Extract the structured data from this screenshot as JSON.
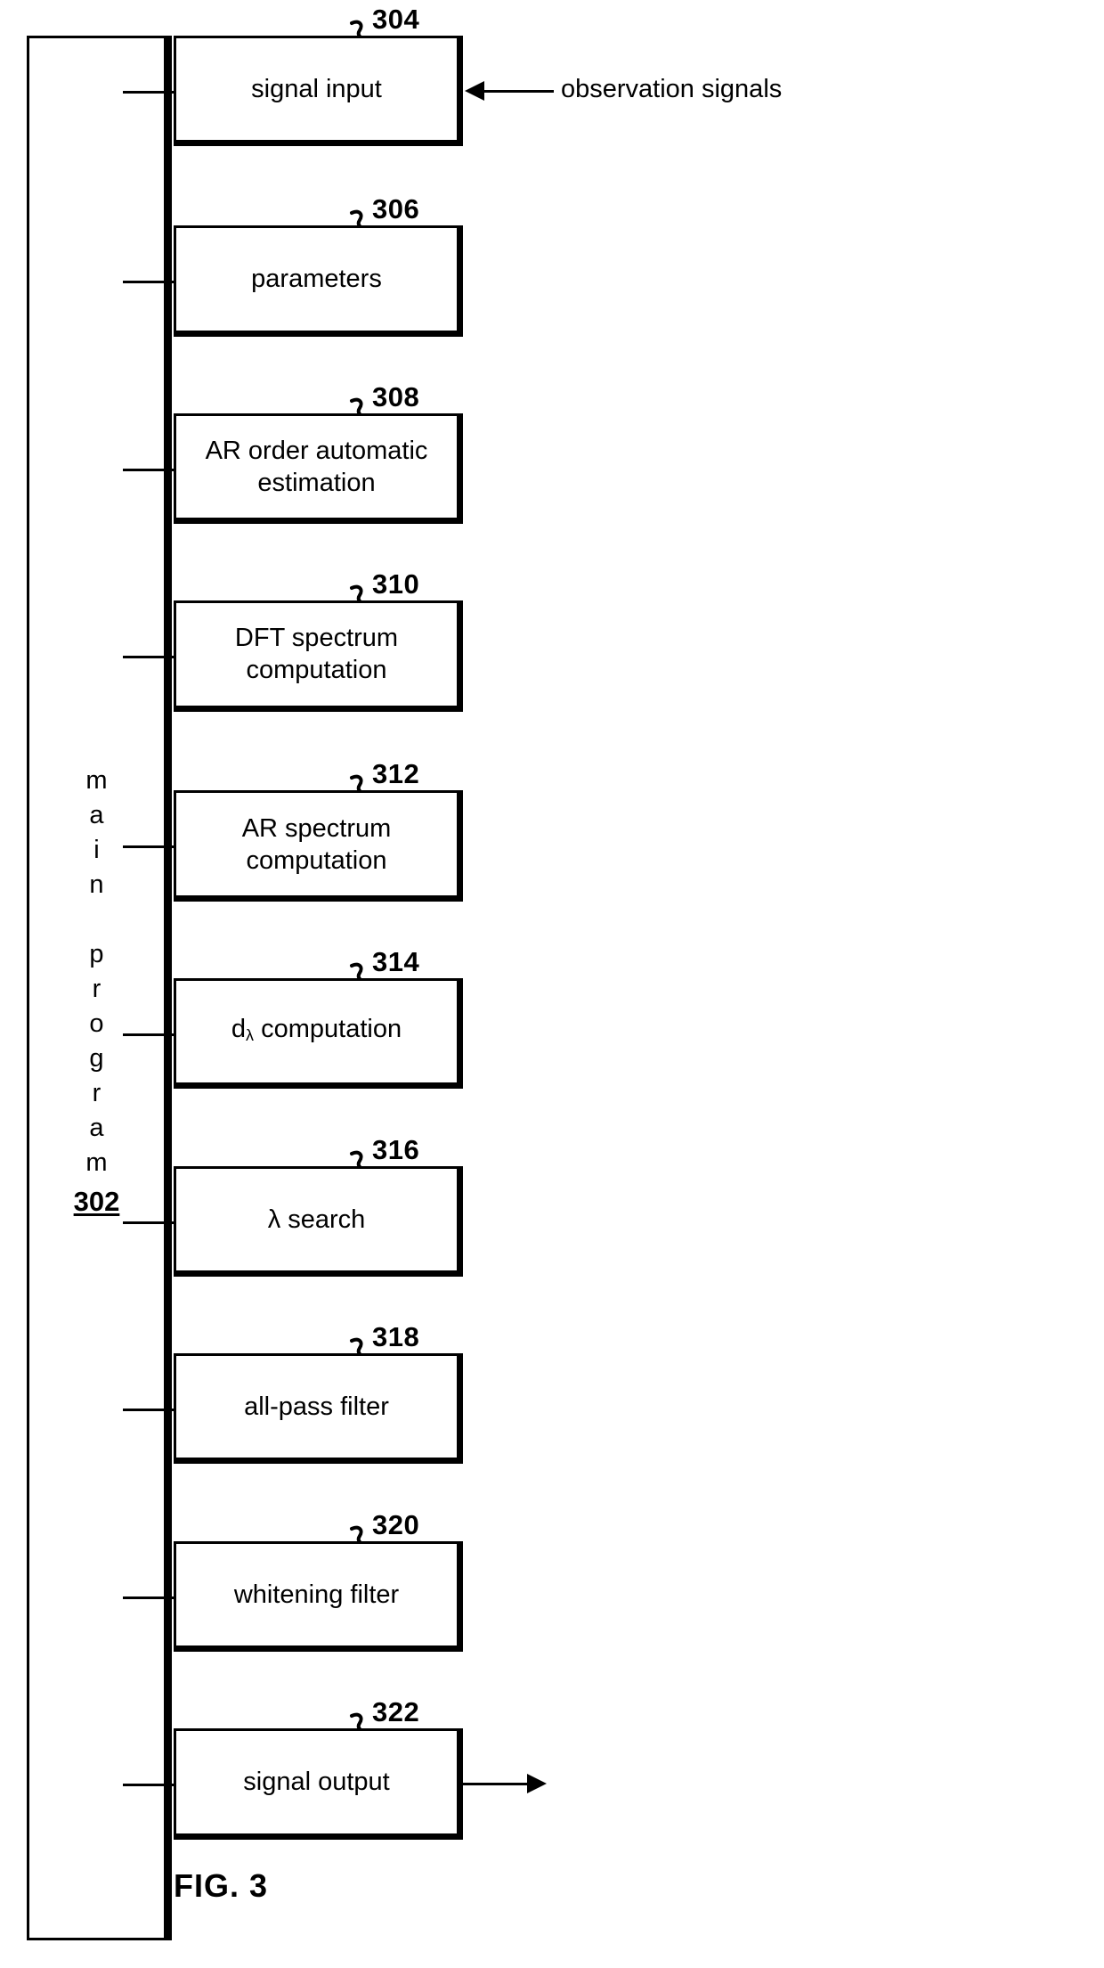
{
  "figure": {
    "caption": "FIG. 3",
    "main_block": {
      "label_text": "main program",
      "label_chars": [
        "m",
        "a",
        "i",
        "n",
        "",
        "p",
        "r",
        "o",
        "g",
        "r",
        "a",
        "m"
      ],
      "reference": "302"
    },
    "external_labels": {
      "input": "observation signals"
    },
    "blocks": [
      {
        "reference": "304",
        "label": "signal input",
        "lines": [
          "signal input"
        ]
      },
      {
        "reference": "306",
        "label": "parameters",
        "lines": [
          "parameters"
        ]
      },
      {
        "reference": "308",
        "label": "AR order automatic estimation",
        "lines": [
          "AR order automatic",
          "estimation"
        ]
      },
      {
        "reference": "310",
        "label": "DFT spectrum computation",
        "lines": [
          "DFT spectrum",
          "computation"
        ]
      },
      {
        "reference": "312",
        "label": "AR spectrum computation",
        "lines": [
          "AR spectrum",
          "computation"
        ]
      },
      {
        "reference": "314",
        "label": "dλ computation",
        "lines": [
          "dλ computation"
        ],
        "subscript": true,
        "base": "d",
        "sub": "λ",
        "rest": " computation"
      },
      {
        "reference": "316",
        "label": "λ search",
        "lines": [
          "λ search"
        ]
      },
      {
        "reference": "318",
        "label": "all-pass filter",
        "lines": [
          "all-pass filter"
        ]
      },
      {
        "reference": "320",
        "label": "whitening filter",
        "lines": [
          "whitening filter"
        ]
      },
      {
        "reference": "322",
        "label": "signal output",
        "lines": [
          "signal output"
        ]
      }
    ]
  },
  "colors": {
    "stroke": "#000000",
    "background": "#ffffff"
  }
}
